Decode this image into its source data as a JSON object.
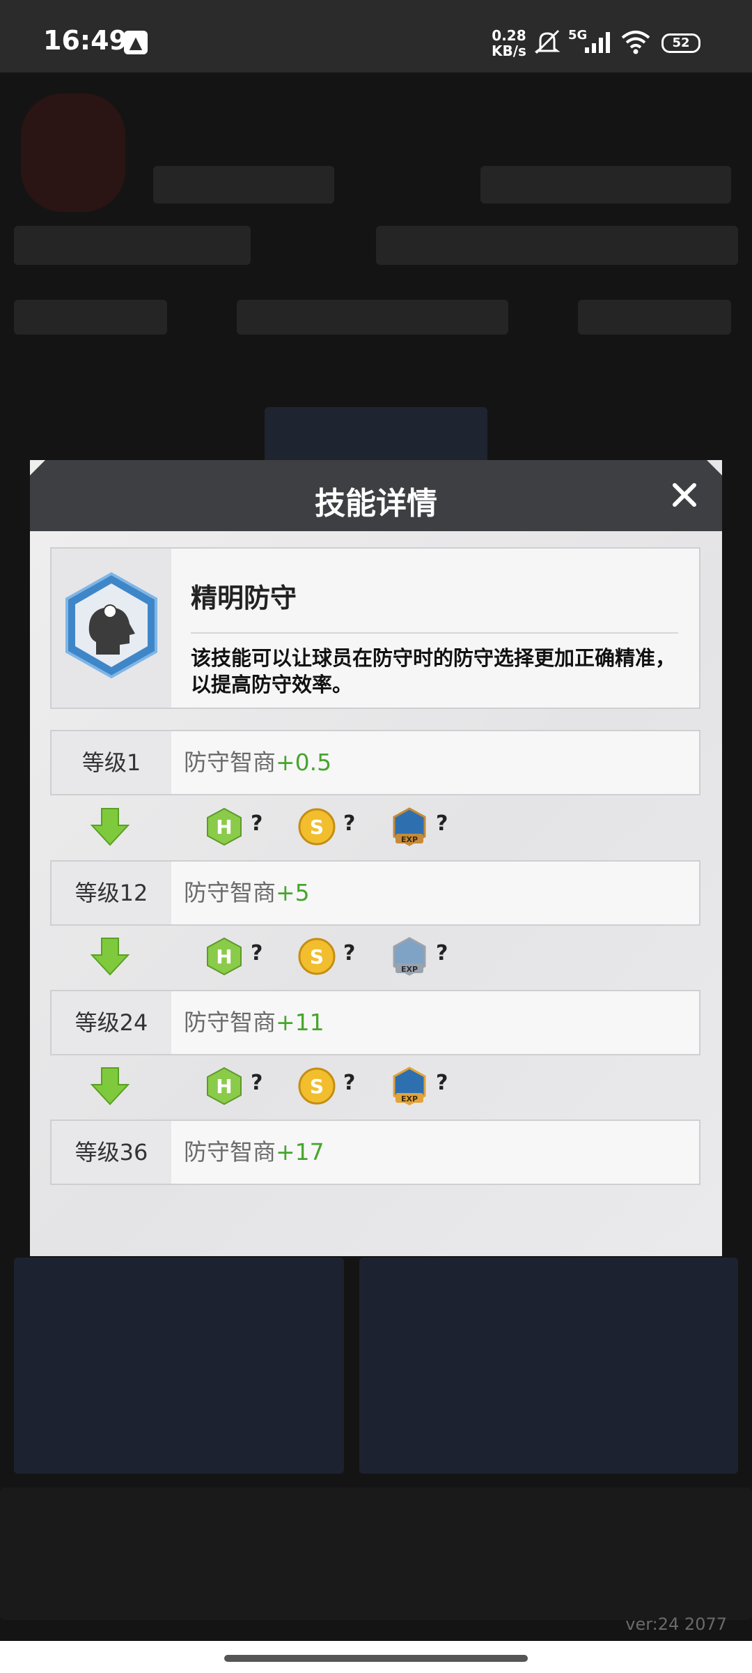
{
  "status_bar": {
    "time": "16:49",
    "net_speed_value": "0.28",
    "net_speed_unit": "KB/s",
    "network_type": "5G",
    "battery": "52"
  },
  "dialog": {
    "title": "技能详情",
    "skill": {
      "name": "精明防守",
      "description": "该技能可以让球员在防守时的防守选择更加正确精准，以提高防守效率。"
    },
    "levels": [
      {
        "label": "等级1",
        "stat": "防守智商",
        "bonus": "+0.5"
      },
      {
        "label": "等级12",
        "stat": "防守智商",
        "bonus": "+5"
      },
      {
        "label": "等级24",
        "stat": "防守智商",
        "bonus": "+11"
      },
      {
        "label": "等级36",
        "stat": "防守智商",
        "bonus": "+17"
      }
    ],
    "upgrade_costs": [
      {
        "h": "?",
        "s": "?",
        "exp": "?"
      },
      {
        "h": "?",
        "s": "?",
        "exp": "?"
      },
      {
        "h": "?",
        "s": "?",
        "exp": "?"
      }
    ]
  },
  "version": "ver:24  2077"
}
